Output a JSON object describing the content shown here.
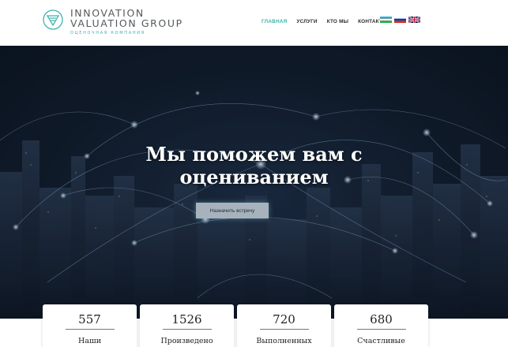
{
  "brand": {
    "line1": "INNOVATION",
    "line2": "VALUATION GROUP",
    "tagline": "ОЦЕНОЧНАЯ КОМПАНИЯ",
    "accent": "#3fb3ad"
  },
  "nav": {
    "items": [
      {
        "label": "ГЛАВНАЯ",
        "active": true
      },
      {
        "label": "УСЛУГИ",
        "active": false
      },
      {
        "label": "КТО МЫ",
        "active": false
      },
      {
        "label": "КОНТАКТЫ",
        "active": false
      }
    ],
    "languages": [
      "uz-flag-icon",
      "ru-flag-icon",
      "uk-flag-icon"
    ]
  },
  "hero": {
    "title_line1": "Мы поможем вам с",
    "title_line2": "оцениванием",
    "button_label": "Назначить встречу"
  },
  "stats": [
    {
      "value": "557",
      "label": "Наши"
    },
    {
      "value": "1526",
      "label": "Произведено"
    },
    {
      "value": "720",
      "label": "Выполненных"
    },
    {
      "value": "680",
      "label": "Счастливые"
    }
  ]
}
